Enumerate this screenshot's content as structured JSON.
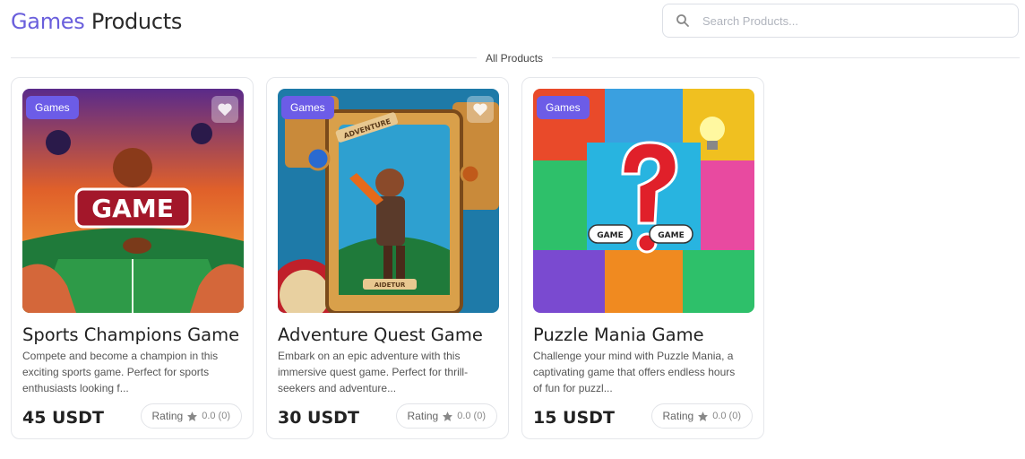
{
  "header": {
    "title_accent": "Games",
    "title_rest": "Products"
  },
  "search": {
    "placeholder": "Search Products..."
  },
  "section": {
    "label": "All Products"
  },
  "products": [
    {
      "category": "Games",
      "image_text": "GAME",
      "name": "Sports Champions Game",
      "description": "Compete and become a champion in this exciting sports game. Perfect for sports enthusiasts looking f...",
      "price": "45 USDT",
      "rating_label": "Rating",
      "rating_value": "0.0 (0)"
    },
    {
      "category": "Games",
      "image_text": "ADVENTURE",
      "image_text2": "AIDETUR",
      "name": "Adventure Quest Game",
      "description": "Embark on an epic adventure with this immersive quest game. Perfect for thrill-seekers and adventure...",
      "price": "30 USDT",
      "rating_label": "Rating",
      "rating_value": "0.0 (0)"
    },
    {
      "category": "Games",
      "image_text": "GAME",
      "image_text2": "GAME",
      "name": "Puzzle Mania Game",
      "description": "Challenge your mind with Puzzle Mania, a captivating game that offers endless hours of fun for puzzl...",
      "price": "15 USDT",
      "rating_label": "Rating",
      "rating_value": "0.0 (0)"
    }
  ],
  "colors": {
    "accent": "#6a5fdc",
    "badge": "#6c5ce7"
  }
}
